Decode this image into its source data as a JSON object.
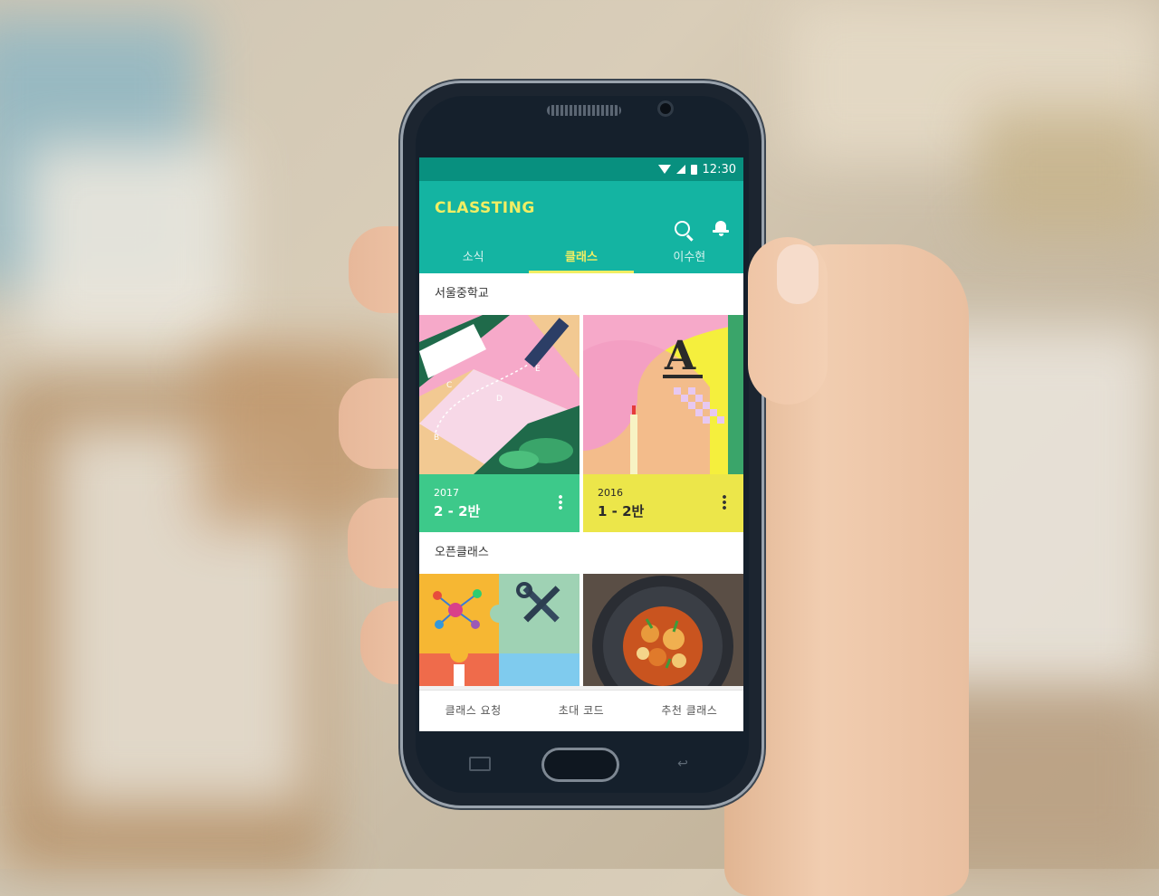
{
  "status_bar": {
    "time": "12:30"
  },
  "app": {
    "title": "CLASSTING"
  },
  "tabs": [
    {
      "label": "소식",
      "active": false
    },
    {
      "label": "클래스",
      "active": true
    },
    {
      "label": "이수현",
      "active": false
    }
  ],
  "school_section": {
    "title": "서울중학교",
    "classes": [
      {
        "year": "2017",
        "name": "2 - 2반",
        "color": "#3dc98a"
      },
      {
        "year": "2016",
        "name": "1 - 2반",
        "color": "#ece64a"
      }
    ]
  },
  "open_section": {
    "title": "오픈클래스"
  },
  "bottom_actions": [
    {
      "label": "클래스 요청"
    },
    {
      "label": "초대 코드"
    },
    {
      "label": "추천 클래스"
    }
  ],
  "colors": {
    "status_bar": "#08907f",
    "app_bar": "#14b4a2",
    "accent": "#f1ee63"
  }
}
